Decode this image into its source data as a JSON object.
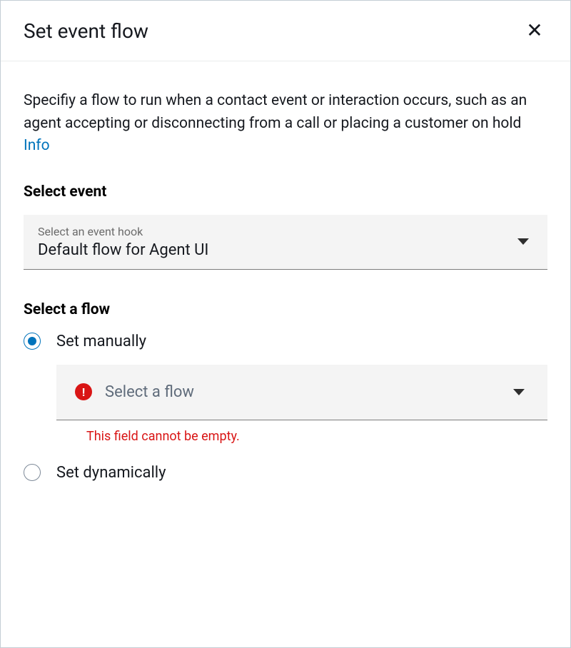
{
  "header": {
    "title": "Set event flow"
  },
  "description": {
    "text": "Specifiy a flow to run when a contact event or interaction occurs, such as an agent accepting or disconnecting from a call or placing a customer on hold ",
    "info_label": "Info"
  },
  "select_event": {
    "label": "Select event",
    "hint": "Select an event hook",
    "value": "Default flow for Agent UI"
  },
  "select_flow": {
    "label": "Select a flow",
    "options": {
      "manual": "Set manually",
      "dynamic": "Set dynamically"
    },
    "flow_placeholder": "Select a flow",
    "error": "This field cannot be empty."
  }
}
